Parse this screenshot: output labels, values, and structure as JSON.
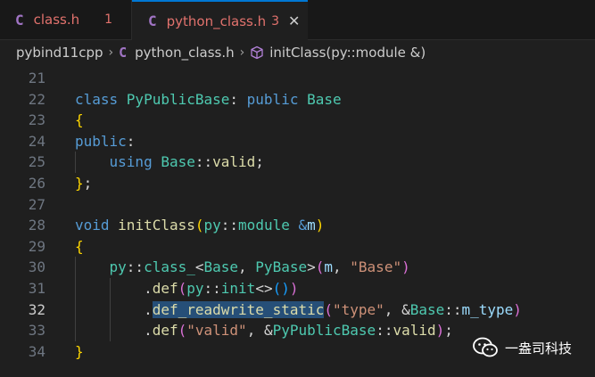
{
  "tabs": [
    {
      "icon": "C",
      "name": "class.h",
      "count": "1"
    },
    {
      "icon": "C",
      "name": "python_class.h",
      "count": "3",
      "close": "✕"
    }
  ],
  "breadcrumb": {
    "folder": "pybind11cpp",
    "file_icon": "C",
    "file": "python_class.h",
    "symbol": "initClass(py::module &)",
    "separator": "›"
  },
  "editor": {
    "active_line": "32",
    "lines": [
      {
        "n": "21",
        "tokens": []
      },
      {
        "n": "22",
        "tokens": [
          {
            "t": "class ",
            "c": "kw"
          },
          {
            "t": "PyPublicBase",
            "c": "type"
          },
          {
            "t": ": ",
            "c": "pun"
          },
          {
            "t": "public ",
            "c": "kw"
          },
          {
            "t": "Base",
            "c": "type"
          }
        ]
      },
      {
        "n": "23",
        "tokens": [
          {
            "t": "{",
            "c": "b1"
          }
        ]
      },
      {
        "n": "24",
        "tokens": [
          {
            "t": "public",
            "c": "kw"
          },
          {
            "t": ":",
            "c": "pun"
          }
        ]
      },
      {
        "n": "25",
        "tokens": [
          {
            "t": "    "
          },
          {
            "t": "using ",
            "c": "kw"
          },
          {
            "t": "Base",
            "c": "type"
          },
          {
            "t": "::",
            "c": "pun"
          },
          {
            "t": "valid",
            "c": "fn"
          },
          {
            "t": ";",
            "c": "pun"
          }
        ]
      },
      {
        "n": "26",
        "tokens": [
          {
            "t": "}",
            "c": "b1"
          },
          {
            "t": ";",
            "c": "pun"
          }
        ]
      },
      {
        "n": "27",
        "tokens": []
      },
      {
        "n": "28",
        "tokens": [
          {
            "t": "void ",
            "c": "kw"
          },
          {
            "t": "initClass",
            "c": "fn"
          },
          {
            "t": "(",
            "c": "b1"
          },
          {
            "t": "py",
            "c": "type"
          },
          {
            "t": "::",
            "c": "pun"
          },
          {
            "t": "module",
            "c": "type"
          },
          {
            "t": " &",
            "c": "kw"
          },
          {
            "t": "m",
            "c": "var"
          },
          {
            "t": ")",
            "c": "b1"
          }
        ]
      },
      {
        "n": "29",
        "tokens": [
          {
            "t": "{",
            "c": "b1"
          }
        ]
      },
      {
        "n": "30",
        "tokens": [
          {
            "t": "    "
          },
          {
            "t": "py",
            "c": "type"
          },
          {
            "t": "::",
            "c": "pun"
          },
          {
            "t": "class_",
            "c": "type"
          },
          {
            "t": "<",
            "c": "pun"
          },
          {
            "t": "Base",
            "c": "type"
          },
          {
            "t": ", ",
            "c": "pun"
          },
          {
            "t": "PyBase",
            "c": "type"
          },
          {
            "t": ">",
            "c": "pun"
          },
          {
            "t": "(",
            "c": "b2"
          },
          {
            "t": "m",
            "c": "var"
          },
          {
            "t": ", ",
            "c": "pun"
          },
          {
            "t": "\"Base\"",
            "c": "str"
          },
          {
            "t": ")",
            "c": "b2"
          }
        ]
      },
      {
        "n": "31",
        "tokens": [
          {
            "t": "        "
          },
          {
            "t": ".",
            "c": "pun"
          },
          {
            "t": "def",
            "c": "fn"
          },
          {
            "t": "(",
            "c": "b2"
          },
          {
            "t": "py",
            "c": "type"
          },
          {
            "t": "::",
            "c": "pun"
          },
          {
            "t": "init",
            "c": "type"
          },
          {
            "t": "<>",
            "c": "pun"
          },
          {
            "t": "()",
            "c": "b3"
          },
          {
            "t": ")",
            "c": "b2"
          }
        ]
      },
      {
        "n": "32",
        "tokens": [
          {
            "t": "        "
          },
          {
            "t": ".",
            "c": "pun"
          },
          {
            "t": "def_readwrite_static",
            "c": "fn hl"
          },
          {
            "t": "(",
            "c": "b2"
          },
          {
            "t": "\"type\"",
            "c": "str"
          },
          {
            "t": ", &",
            "c": "pun"
          },
          {
            "t": "Base",
            "c": "type"
          },
          {
            "t": "::",
            "c": "pun"
          },
          {
            "t": "m_type",
            "c": "var"
          },
          {
            "t": ")",
            "c": "b2"
          }
        ]
      },
      {
        "n": "33",
        "tokens": [
          {
            "t": "        "
          },
          {
            "t": ".",
            "c": "pun"
          },
          {
            "t": "def",
            "c": "fn"
          },
          {
            "t": "(",
            "c": "b2"
          },
          {
            "t": "\"valid\"",
            "c": "str"
          },
          {
            "t": ", &",
            "c": "pun"
          },
          {
            "t": "PyPublicBase",
            "c": "type"
          },
          {
            "t": "::",
            "c": "pun"
          },
          {
            "t": "valid",
            "c": "fn"
          },
          {
            "t": ")",
            "c": "b2"
          },
          {
            "t": ";",
            "c": "pun"
          }
        ]
      },
      {
        "n": "34",
        "tokens": [
          {
            "t": "}",
            "c": "b1"
          }
        ]
      }
    ]
  },
  "watermark": {
    "text": "一盎司科技",
    "icon": "wechat-icon"
  },
  "colors": {
    "background": "#1f1f1f",
    "tab_accent": "#0078d4",
    "error_text": "#e2726d",
    "c_icon": "#a074c4",
    "selection": "#264f78"
  }
}
